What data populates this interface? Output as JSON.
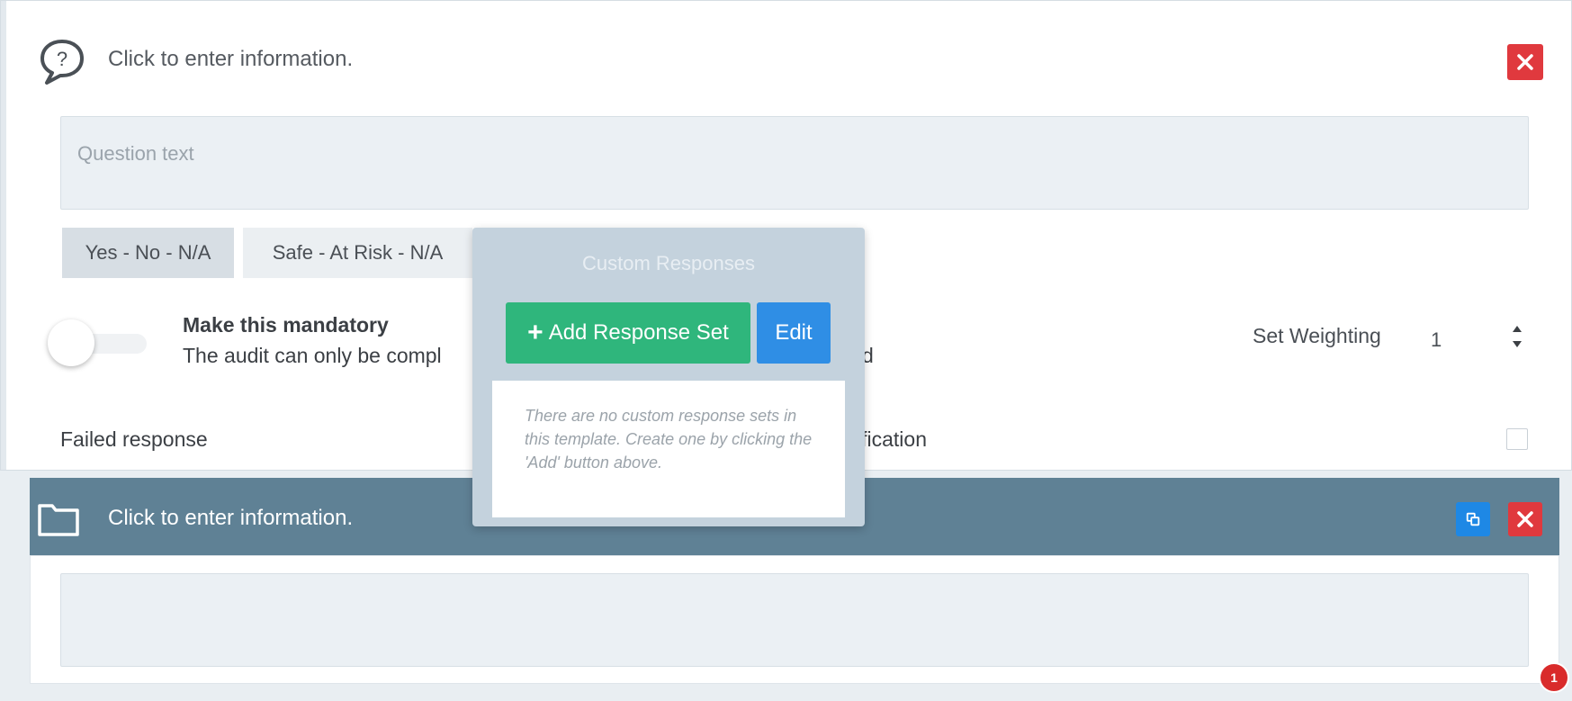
{
  "question": {
    "header_text": "Click to enter information.",
    "question_placeholder": "Question text",
    "response_tabs": [
      {
        "label": "Yes - No - N/A",
        "active": true
      },
      {
        "label": "Safe - At Risk - N/A",
        "active": false
      }
    ],
    "mandatory": {
      "title": "Make this mandatory",
      "description": "The audit can only be compl",
      "description_tail": "d",
      "enabled": false
    },
    "weighting": {
      "label": "Set Weighting",
      "value": "1"
    },
    "failed_response_label": "Failed response",
    "notification_label": "ification",
    "notification_checked": false
  },
  "custom_responses": {
    "title": "Custom Responses",
    "add_button_label": "Add Response Set",
    "edit_button_label": "Edit",
    "empty_note": "There are no custom response sets in this template. Create one by clicking the 'Add' button above."
  },
  "section": {
    "header_text": "Click to enter information.",
    "body_text": ""
  },
  "notification_badge": {
    "count": "1"
  },
  "colors": {
    "danger": "#e0393e",
    "success": "#2fb67c",
    "primary": "#2f8ee5",
    "section_header": "#5f8195"
  },
  "icons": {
    "question": "speech-bubble-question-icon",
    "section": "folder-icon",
    "close": "close-icon",
    "copy": "copy-icon",
    "add": "plus-icon"
  }
}
